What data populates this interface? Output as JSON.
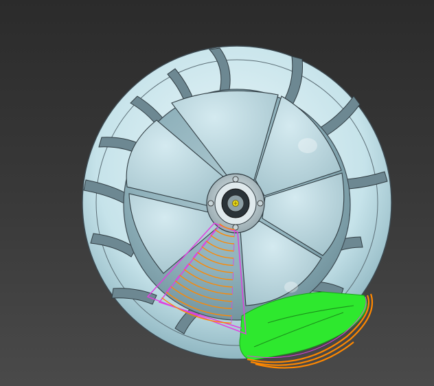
{
  "viewport": {
    "kind": "3d-cad-viewport",
    "background_top": "#2b2b2b",
    "background_bottom": "#4a4a4a"
  },
  "model": {
    "part": "impeller",
    "blade_count": 8,
    "body_color": "#cde6ec",
    "outline_color": "#3c4a52"
  },
  "toolpath": {
    "primary_color": "#ff8800",
    "secondary_color": "#e040e0",
    "stock_color": "#2ee82e",
    "pass_count": 14
  },
  "icons": {
    "hub_center": "hub-center-marker-icon"
  }
}
